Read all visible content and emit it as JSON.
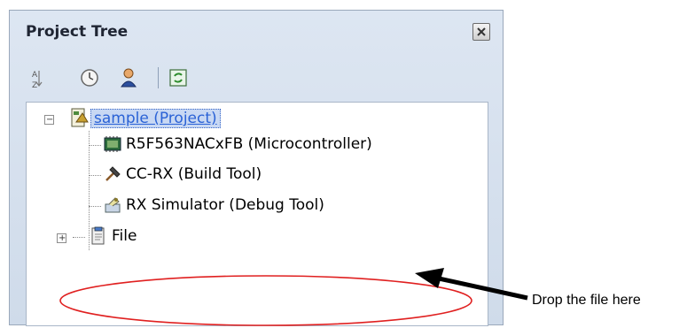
{
  "panel": {
    "title": "Project Tree",
    "close_icon": "close-icon"
  },
  "toolbar": {
    "buttons": [
      {
        "name": "sort-icon"
      },
      {
        "name": "clock-icon"
      },
      {
        "name": "user-icon"
      },
      {
        "name": "refresh-icon"
      }
    ]
  },
  "tree": {
    "root": {
      "label": "sample (Project)",
      "icon": "project-icon",
      "expanded": true,
      "selected": true
    },
    "children": [
      {
        "label": "R5F563NACxFB (Microcontroller)",
        "icon": "microcontroller-icon"
      },
      {
        "label": "CC-RX (Build Tool)",
        "icon": "hammer-icon"
      },
      {
        "label": "RX Simulator (Debug Tool)",
        "icon": "debug-tool-icon"
      },
      {
        "label": "File",
        "icon": "file-folder-icon",
        "expanded": false
      }
    ]
  },
  "annotation": {
    "text": "Drop the file here",
    "ellipse_color": "#e02020",
    "arrow_color": "#000000"
  }
}
